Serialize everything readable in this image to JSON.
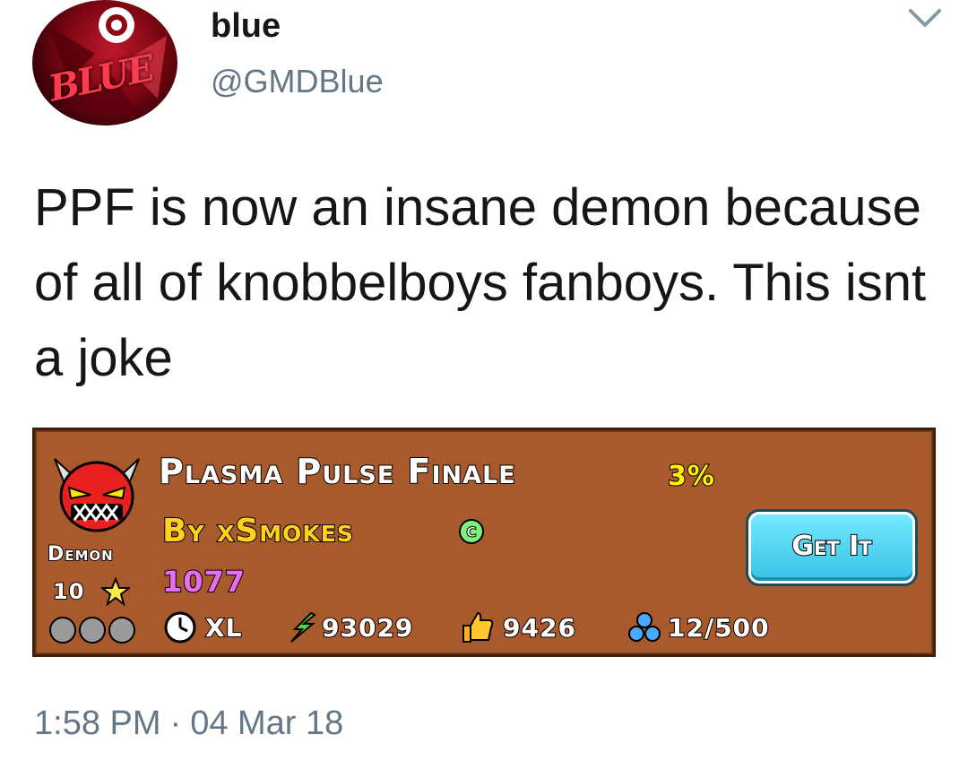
{
  "author": {
    "display_name": "blue",
    "handle": "@GMDBlue",
    "avatar_text": "BLUE"
  },
  "tweet": {
    "text": "PPF is now an insane demon because of all of knobbelboys fanboys. This isnt a joke",
    "time": "1:58 PM",
    "separator": "·",
    "date": "04 Mar 18"
  },
  "level_card": {
    "name": "Plasma Pulse Finale",
    "percent": "3%",
    "author": "By xSmokes",
    "level_id": "1077",
    "difficulty": "Demon",
    "stars": "10",
    "length": "XL",
    "downloads": "93029",
    "likes": "9426",
    "orbs": "12/500",
    "get_button": "Get It",
    "colors": {
      "background": "#a85a2c",
      "title": "#ffffff",
      "author": "#ffd21a",
      "level_id": "#e86cf4",
      "percent": "#fff200",
      "button": "#35c2e6"
    }
  }
}
